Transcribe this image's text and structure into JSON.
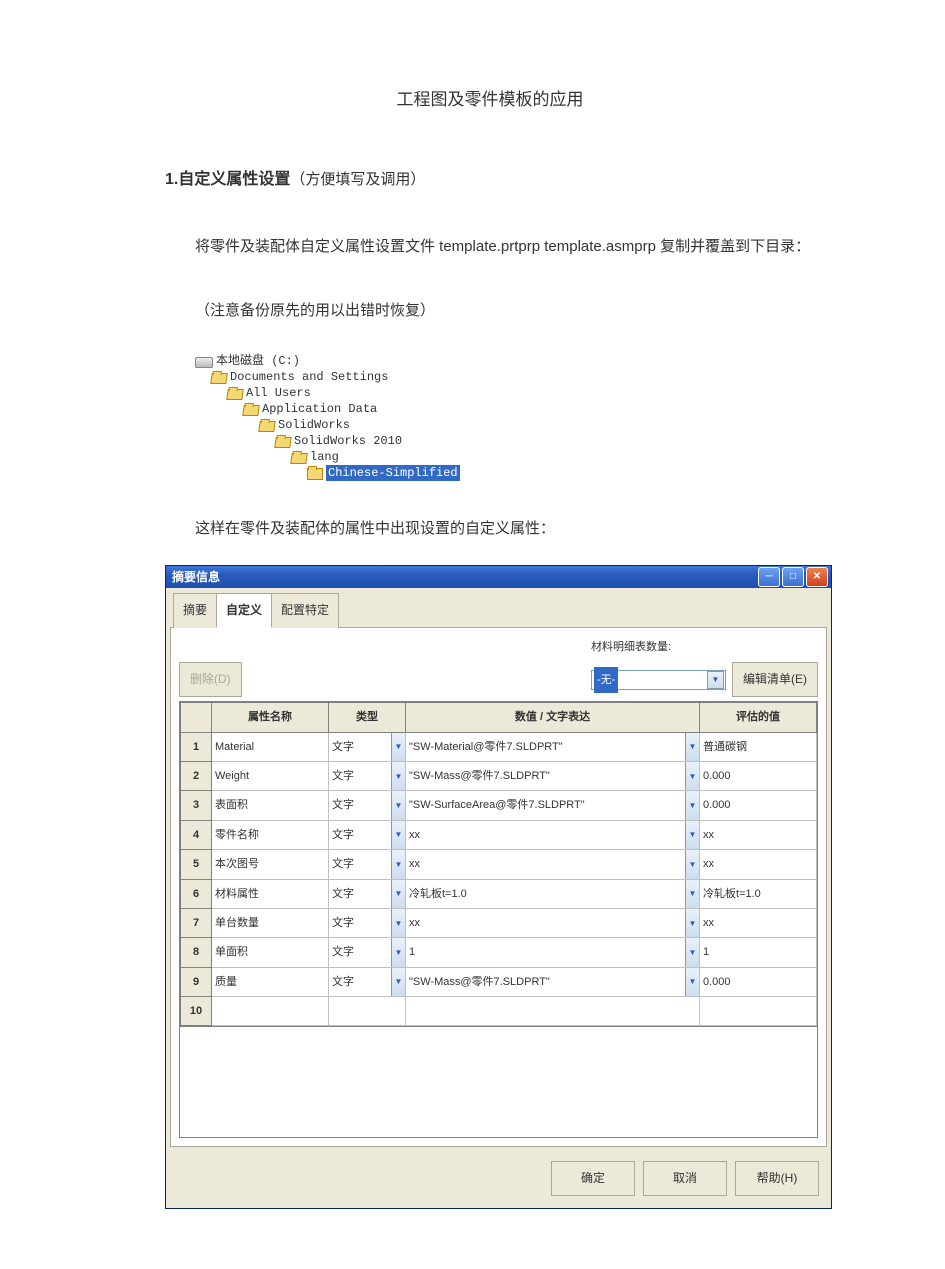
{
  "doc": {
    "title": "工程图及零件模板的应用",
    "section1_heading_bold": "1.自定义属性设置",
    "section1_heading_paren": "（方便填写及调用）",
    "para1": "将零件及装配体自定义属性设置文件 template.prtprp template.asmprp 复制并覆盖到下目录：",
    "note": "（注意备份原先的用以出错时恢复）",
    "para2": "这样在零件及装配体的属性中出现设置的自定义属性："
  },
  "tree": {
    "items": [
      {
        "level": 0,
        "icon": "disk",
        "label": "本地磁盘 (C:)"
      },
      {
        "level": 1,
        "icon": "folder-open",
        "label": "Documents and Settings"
      },
      {
        "level": 2,
        "icon": "folder-open",
        "label": "All Users"
      },
      {
        "level": 3,
        "icon": "folder-open",
        "label": "Application Data"
      },
      {
        "level": 4,
        "icon": "folder-open",
        "label": "SolidWorks"
      },
      {
        "level": 5,
        "icon": "folder-open",
        "label": "SolidWorks 2010"
      },
      {
        "level": 6,
        "icon": "folder-open",
        "label": "lang"
      },
      {
        "level": 7,
        "icon": "folder",
        "label": "Chinese-Simplified",
        "selected": true
      }
    ]
  },
  "dialog": {
    "title": "摘要信息",
    "tabs": [
      "摘要",
      "自定义",
      "配置特定"
    ],
    "active_tab": 1,
    "delete_btn": "删除(D)",
    "material_label": "材料明细表数量:",
    "material_value": "-无-",
    "edit_list_btn": "编辑清单(E)",
    "columns": [
      "",
      "属性名称",
      "类型",
      "数值 / 文字表达",
      "评估的值"
    ],
    "rows": [
      {
        "n": "1",
        "name": "Material",
        "type": "文字",
        "expr": "\"SW-Material@零件7.SLDPRT\"",
        "val": "普通碳钢"
      },
      {
        "n": "2",
        "name": "Weight",
        "type": "文字",
        "expr": "\"SW-Mass@零件7.SLDPRT\"",
        "val": "0.000"
      },
      {
        "n": "3",
        "name": "表面积",
        "type": "文字",
        "expr": "\"SW-SurfaceArea@零件7.SLDPRT\"",
        "val": "0.000"
      },
      {
        "n": "4",
        "name": "零件名称",
        "type": "文字",
        "expr": "xx",
        "val": "xx"
      },
      {
        "n": "5",
        "name": "本次图号",
        "type": "文字",
        "expr": "xx",
        "val": "xx"
      },
      {
        "n": "6",
        "name": "材料属性",
        "type": "文字",
        "expr": "冷轧板t=1.0",
        "val": "冷轧板t=1.0"
      },
      {
        "n": "7",
        "name": "单台数量",
        "type": "文字",
        "expr": "xx",
        "val": "xx"
      },
      {
        "n": "8",
        "name": "单面积",
        "type": "文字",
        "expr": "1",
        "val": "1"
      },
      {
        "n": "9",
        "name": "质量",
        "type": "文字",
        "expr": "\"SW-Mass@零件7.SLDPRT\"",
        "val": "0.000"
      },
      {
        "n": "10",
        "name": "",
        "type": "",
        "expr": "",
        "val": ""
      }
    ],
    "ok": "确定",
    "cancel": "取消",
    "help": "帮助(H)"
  }
}
